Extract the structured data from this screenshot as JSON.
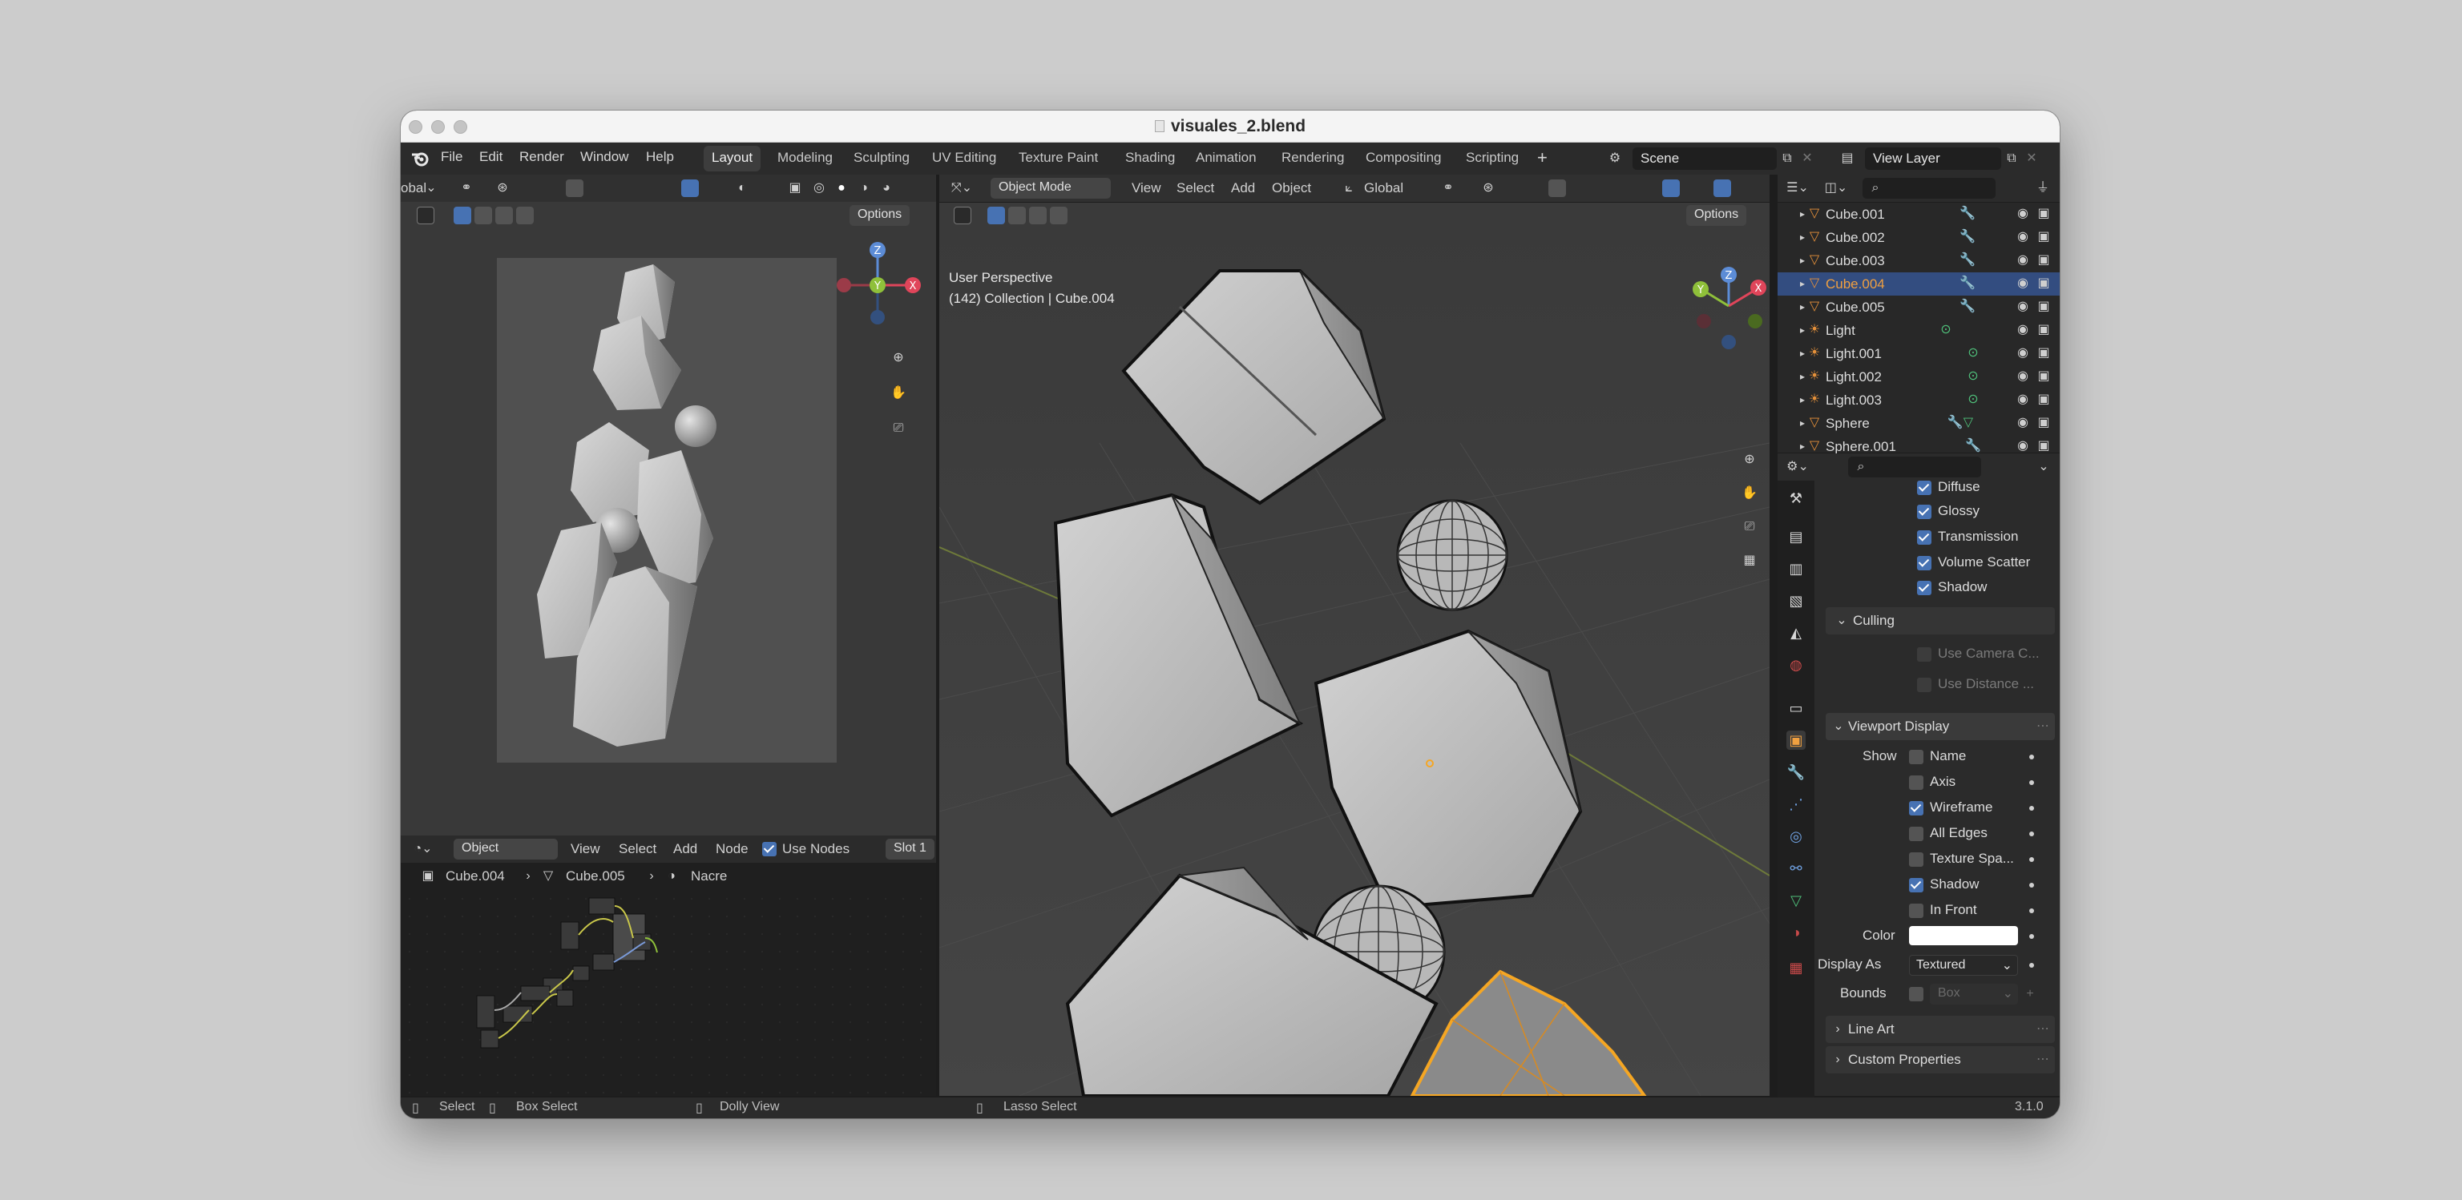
{
  "window": {
    "title": "visuales_2.blend"
  },
  "menu": [
    "File",
    "Edit",
    "Render",
    "Window",
    "Help"
  ],
  "workspaces": [
    "Layout",
    "Modeling",
    "Sculpting",
    "UV Editing",
    "Texture Paint",
    "Shading",
    "Animation",
    "Rendering",
    "Compositing",
    "Scripting"
  ],
  "active_workspace": "Layout",
  "scene": {
    "name": "Scene"
  },
  "view_layer": {
    "name": "View Layer"
  },
  "left_viewport": {
    "header_prefix": "obal",
    "options": "Options"
  },
  "main_viewport": {
    "mode": "Object Mode",
    "menus": [
      "View",
      "Select",
      "Add",
      "Object"
    ],
    "orientation": "Global",
    "options": "Options",
    "overlay_title": "User Perspective",
    "overlay_subtitle": "(142) Collection | Cube.004"
  },
  "gizmo": {
    "x": "X",
    "y": "Y",
    "z": "Z"
  },
  "node_editor": {
    "type": "Object",
    "menus": [
      "View",
      "Select",
      "Add",
      "Node"
    ],
    "use_nodes": "Use Nodes",
    "slot": "Slot 1",
    "breadcrumb": [
      "Cube.004",
      "Cube.005",
      "Nacre"
    ]
  },
  "outliner": {
    "items": [
      {
        "name": "Cube.001",
        "kind": "mesh"
      },
      {
        "name": "Cube.002",
        "kind": "mesh"
      },
      {
        "name": "Cube.003",
        "kind": "mesh"
      },
      {
        "name": "Cube.004",
        "kind": "mesh",
        "selected": true
      },
      {
        "name": "Cube.005",
        "kind": "mesh"
      },
      {
        "name": "Light",
        "kind": "light"
      },
      {
        "name": "Light.001",
        "kind": "light"
      },
      {
        "name": "Light.002",
        "kind": "light"
      },
      {
        "name": "Light.003",
        "kind": "light"
      },
      {
        "name": "Sphere",
        "kind": "mesh"
      },
      {
        "name": "Sphere.001",
        "kind": "mesh"
      }
    ]
  },
  "properties": {
    "visibility": [
      {
        "label": "Diffuse",
        "checked": true
      },
      {
        "label": "Glossy",
        "checked": true
      },
      {
        "label": "Transmission",
        "checked": true
      },
      {
        "label": "Volume Scatter",
        "checked": true
      },
      {
        "label": "Shadow",
        "checked": true
      }
    ],
    "culling": {
      "title": "Culling",
      "camera": "Use Camera C...",
      "distance": "Use Distance ..."
    },
    "viewport_display": {
      "title": "Viewport Display",
      "show_label": "Show",
      "options": [
        {
          "label": "Name",
          "checked": false
        },
        {
          "label": "Axis",
          "checked": false
        },
        {
          "label": "Wireframe",
          "checked": true
        },
        {
          "label": "All Edges",
          "checked": false
        },
        {
          "label": "Texture Spa...",
          "checked": false
        },
        {
          "label": "Shadow",
          "checked": true
        },
        {
          "label": "In Front",
          "checked": false
        }
      ],
      "color_label": "Color",
      "color_value": "#ffffff",
      "display_as_label": "Display As",
      "display_as_value": "Textured",
      "bounds_label": "Bounds",
      "bounds_value": "Box"
    },
    "line_art": "Line Art",
    "custom_properties": "Custom Properties"
  },
  "status_bar": {
    "select": "Select",
    "box_select": "Box Select",
    "dolly": "Dolly View",
    "lasso": "Lasso Select",
    "version": "3.1.0"
  },
  "colors": {
    "accent": "#4772b3",
    "selection_orange": "#f5a623",
    "outliner_selected": "#334d80",
    "selected_name": "#f0a040"
  }
}
